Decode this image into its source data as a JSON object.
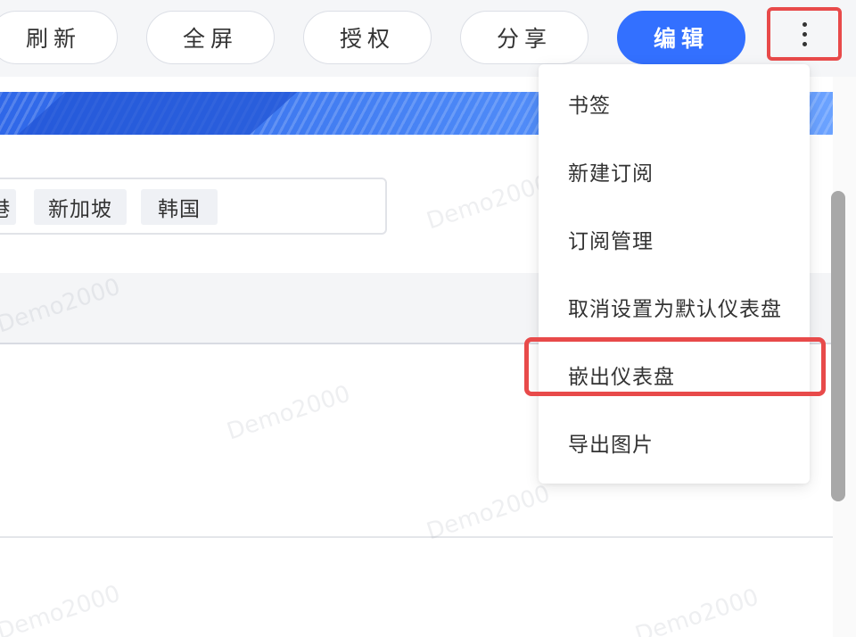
{
  "toolbar": {
    "buttons": [
      {
        "label": "刷新"
      },
      {
        "label": "全屏"
      },
      {
        "label": "授权"
      },
      {
        "label": "分享"
      },
      {
        "label": "编辑"
      }
    ],
    "more_icon": "more-vertical-icon",
    "primary_color": "#3370ff"
  },
  "filter": {
    "tags": [
      "港",
      "新加坡",
      "韩国"
    ]
  },
  "watermark": {
    "text": "Demo2000"
  },
  "menu": {
    "items": [
      {
        "label": "书签"
      },
      {
        "label": "新建订阅"
      },
      {
        "label": "订阅管理"
      },
      {
        "label": "取消设置为默认仪表盘"
      },
      {
        "label": "嵌出仪表盘"
      },
      {
        "label": "导出图片"
      }
    ],
    "highlighted_index": 4,
    "highlight_color": "#e84a4a"
  }
}
